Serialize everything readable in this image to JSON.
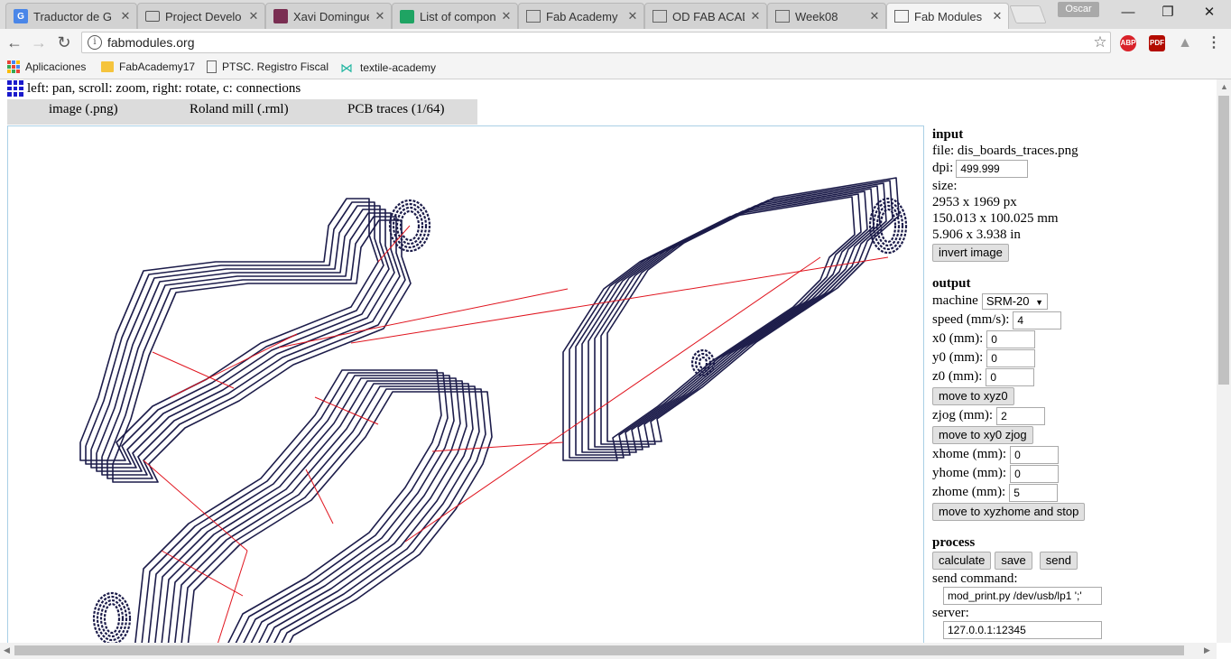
{
  "browser": {
    "tabs": [
      {
        "label": "Traductor de G",
        "icon": "google-translate-icon",
        "active": false
      },
      {
        "label": "Project Develo",
        "icon": "book-icon",
        "active": false
      },
      {
        "label": "Xavi Dominguez",
        "icon": "avatar-icon",
        "active": false
      },
      {
        "label": "List of compon",
        "icon": "sheets-icon",
        "active": false
      },
      {
        "label": "Fab Academy",
        "icon": "page-icon",
        "active": false
      },
      {
        "label": "OD FAB ACADE",
        "icon": "page-icon",
        "active": false
      },
      {
        "label": "Week08",
        "icon": "page-icon",
        "active": false
      },
      {
        "label": "Fab Modules",
        "icon": "page-icon",
        "active": true
      }
    ],
    "profile_name": "Oscar",
    "url": "fabmodules.org",
    "bookmarks": [
      {
        "label": "Aplicaciones",
        "icon": "apps-grid-icon"
      },
      {
        "label": "FabAcademy17",
        "icon": "folder-icon"
      },
      {
        "label": "PTSC. Registro Fiscal",
        "icon": "page-icon"
      },
      {
        "label": "textile-academy",
        "icon": "textile-logo-icon"
      }
    ],
    "extensions": [
      {
        "label": "ABP",
        "color": "#d9222a"
      },
      {
        "label": "PDF",
        "color": "#b30b00"
      }
    ]
  },
  "page": {
    "hint": "left: pan, scroll: zoom, right: rotate, c: connections",
    "module_tabs": [
      "image (.png)",
      "Roland mill (.rml)",
      "PCB traces (1/64)"
    ],
    "input": {
      "heading": "input",
      "file": "file: dis_boards_traces.png",
      "dpi_label": "dpi:",
      "dpi": "499.999",
      "size_label": "size:",
      "size_px": "2953 x 1969 px",
      "size_mm": "150.013 x 100.025 mm",
      "size_in": "5.906 x 3.938 in",
      "invert_button": "invert image"
    },
    "output": {
      "heading": "output",
      "machine_label": "machine",
      "machine": "SRM-20",
      "speed_label": "speed (mm/s):",
      "speed": "4",
      "x0_label": "x0 (mm):",
      "x0": "0",
      "y0_label": "y0 (mm):",
      "y0": "0",
      "z0_label": "z0 (mm):",
      "z0": "0",
      "move_xyz0_button": "move to xyz0",
      "zjog_label": "zjog (mm):",
      "zjog": "2",
      "move_xy0_zjog_button": "move to xy0 zjog",
      "xhome_label": "xhome (mm):",
      "xhome": "0",
      "yhome_label": "yhome (mm):",
      "yhome": "0",
      "zhome_label": "zhome (mm):",
      "zhome": "5",
      "move_home_button": "move to xyzhome and stop"
    },
    "process": {
      "heading": "process",
      "calculate_button": "calculate",
      "save_button": "save",
      "send_button": "send",
      "send_command_label": "send command:",
      "send_command": "mod_print.py /dev/usb/lp1 ';'",
      "server_label": "server:",
      "server": "127.0.0.1:12345"
    },
    "colors": {
      "toolpath": "#1c1c4a",
      "connection": "#e0141e",
      "viewer_border": "#aad0e6"
    }
  }
}
